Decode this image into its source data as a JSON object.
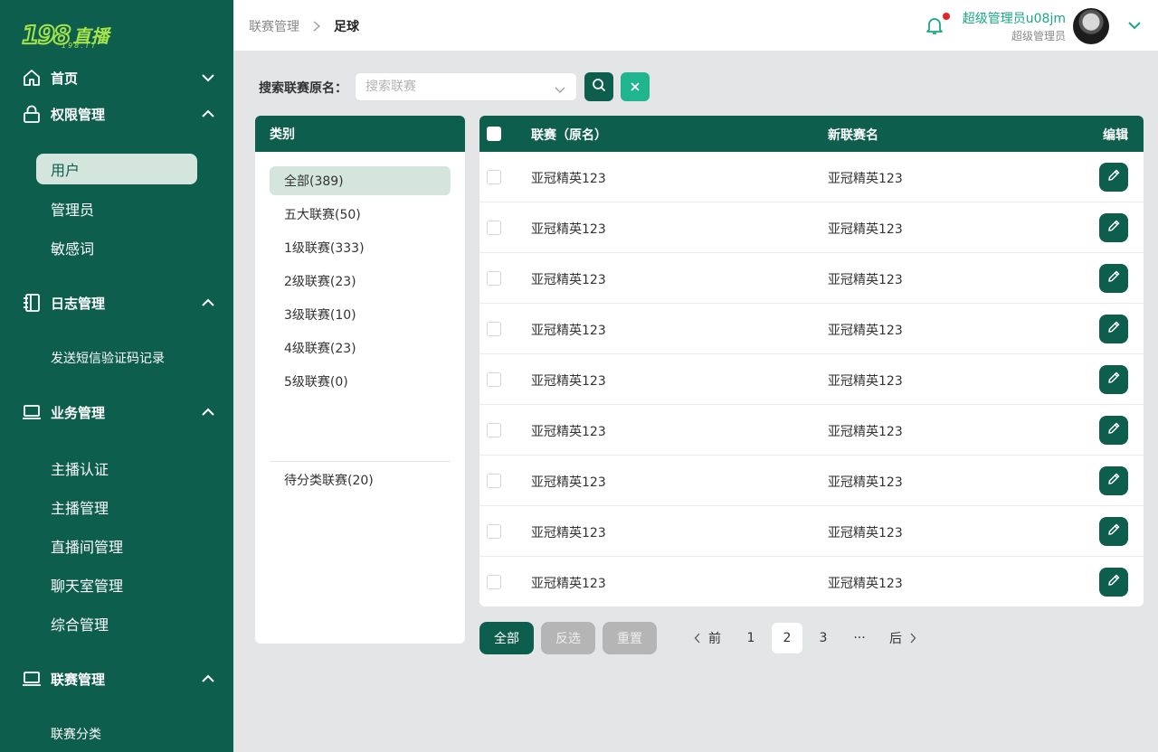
{
  "logo": {
    "text_num": "198",
    "text_cn": "直播",
    "sub": "198.TT"
  },
  "sidebar": {
    "groups": [
      {
        "label": "首页",
        "icon": "home-icon",
        "expanded": false
      },
      {
        "label": "权限管理",
        "icon": "lock-icon",
        "expanded": true
      },
      {
        "label": "日志管理",
        "icon": "notebook-icon",
        "expanded": true
      },
      {
        "label": "业务管理",
        "icon": "laptop-icon",
        "expanded": true
      },
      {
        "label": "联赛管理",
        "icon": "laptop-icon",
        "expanded": true
      }
    ],
    "items": [
      {
        "label": "用户",
        "active": true
      },
      {
        "label": "管理员"
      },
      {
        "label": "敏感词"
      },
      {
        "label": "发送短信验证码记录"
      },
      {
        "label": "主播认证"
      },
      {
        "label": "主播管理"
      },
      {
        "label": "直播间管理"
      },
      {
        "label": "聊天室管理"
      },
      {
        "label": "综合管理"
      },
      {
        "label": "联赛分类"
      }
    ]
  },
  "header": {
    "breadcrumb_parent": "联赛管理",
    "breadcrumb_current": "足球",
    "user_name": "超级管理员u08jm",
    "user_role": "超级管理员",
    "notification_dot_color": "#e0262b"
  },
  "search": {
    "label": "搜索联赛原名：",
    "placeholder": "搜索联赛"
  },
  "categories": {
    "title": "类别",
    "items": [
      {
        "label": "全部(389)",
        "active": true
      },
      {
        "label": "五大联赛(50)"
      },
      {
        "label": "1级联赛(333)"
      },
      {
        "label": "2级联赛(23)"
      },
      {
        "label": "3级联赛(10)"
      },
      {
        "label": "4级联赛(23)"
      },
      {
        "label": "5级联赛(0)"
      }
    ],
    "uncategorized": "待分类联赛(20)"
  },
  "table": {
    "headers": {
      "original": "联赛（原名）",
      "new": "新联赛名",
      "edit": "编辑"
    },
    "rows": [
      {
        "original": "亚冠精英123",
        "new": "亚冠精英123"
      },
      {
        "original": "亚冠精英123",
        "new": "亚冠精英123"
      },
      {
        "original": "亚冠精英123",
        "new": "亚冠精英123"
      },
      {
        "original": "亚冠精英123",
        "new": "亚冠精英123"
      },
      {
        "original": "亚冠精英123",
        "new": "亚冠精英123"
      },
      {
        "original": "亚冠精英123",
        "new": "亚冠精英123"
      },
      {
        "original": "亚冠精英123",
        "new": "亚冠精英123"
      },
      {
        "original": "亚冠精英123",
        "new": "亚冠精英123"
      },
      {
        "original": "亚冠精英123",
        "new": "亚冠精英123"
      }
    ]
  },
  "actions": {
    "select_all": "全部",
    "invert": "反选",
    "reset": "重置"
  },
  "pagination": {
    "prev": "前",
    "next": "后",
    "pages": [
      "1",
      "2",
      "3"
    ],
    "current": "2",
    "ellipsis": "···"
  },
  "colors": {
    "primary": "#0d5e4d",
    "accent": "#1fb58f",
    "active_bg": "#d4e5de",
    "logo": "#a4e34a"
  }
}
